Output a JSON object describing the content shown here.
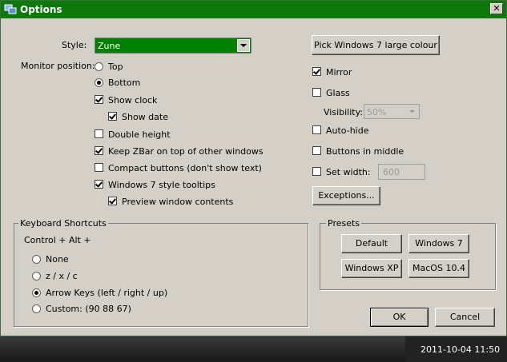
{
  "window": {
    "title": "Options",
    "close_glyph": "✕"
  },
  "style": {
    "label": "Style:",
    "value": "Zune"
  },
  "monitor": {
    "label": "Monitor position:",
    "options": [
      "Top",
      "Bottom"
    ],
    "selected": "Bottom"
  },
  "left_checks": {
    "show_clock": {
      "label": "Show clock",
      "checked": true
    },
    "show_date": {
      "label": "Show date",
      "checked": true
    },
    "double_height": {
      "label": "Double height",
      "checked": false
    },
    "keep_on_top": {
      "label": "Keep ZBar on top of other windows",
      "checked": true
    },
    "compact_buttons": {
      "label": "Compact buttons (don't show text)",
      "checked": false
    },
    "win7_tooltips": {
      "label": "Windows 7 style tooltips",
      "checked": true
    },
    "preview_window": {
      "label": "Preview window contents",
      "checked": true
    }
  },
  "right": {
    "pick_colour": "Pick Windows 7 large colour",
    "mirror": {
      "label": "Mirror",
      "checked": true
    },
    "glass": {
      "label": "Glass",
      "checked": false
    },
    "visibility_label": "Visibility:",
    "visibility_value": "50%",
    "auto_hide": {
      "label": "Auto-hide",
      "checked": false
    },
    "buttons_middle": {
      "label": "Buttons in middle",
      "checked": false
    },
    "set_width": {
      "label": "Set width:",
      "checked": false,
      "value": "600"
    },
    "exceptions": "Exceptions..."
  },
  "keyboard": {
    "title": "Keyboard Shortcuts",
    "modifier": "Control + Alt +",
    "options": [
      "None",
      "z / x / c",
      "Arrow Keys (left / right / up)",
      "Custom: (90 88 67)"
    ],
    "selected": "Arrow Keys (left / right / up)"
  },
  "presets": {
    "title": "Presets",
    "buttons": [
      "Default",
      "Windows 7",
      "Windows XP",
      "MacOS 10.4"
    ]
  },
  "footer": {
    "ok": "OK",
    "cancel": "Cancel"
  },
  "taskbar": {
    "clock": "2011-10-04  11:50"
  },
  "colors": {
    "titlebar": "#0b7a0b",
    "selection": "#008000",
    "dialog": "#d4d0c8"
  }
}
